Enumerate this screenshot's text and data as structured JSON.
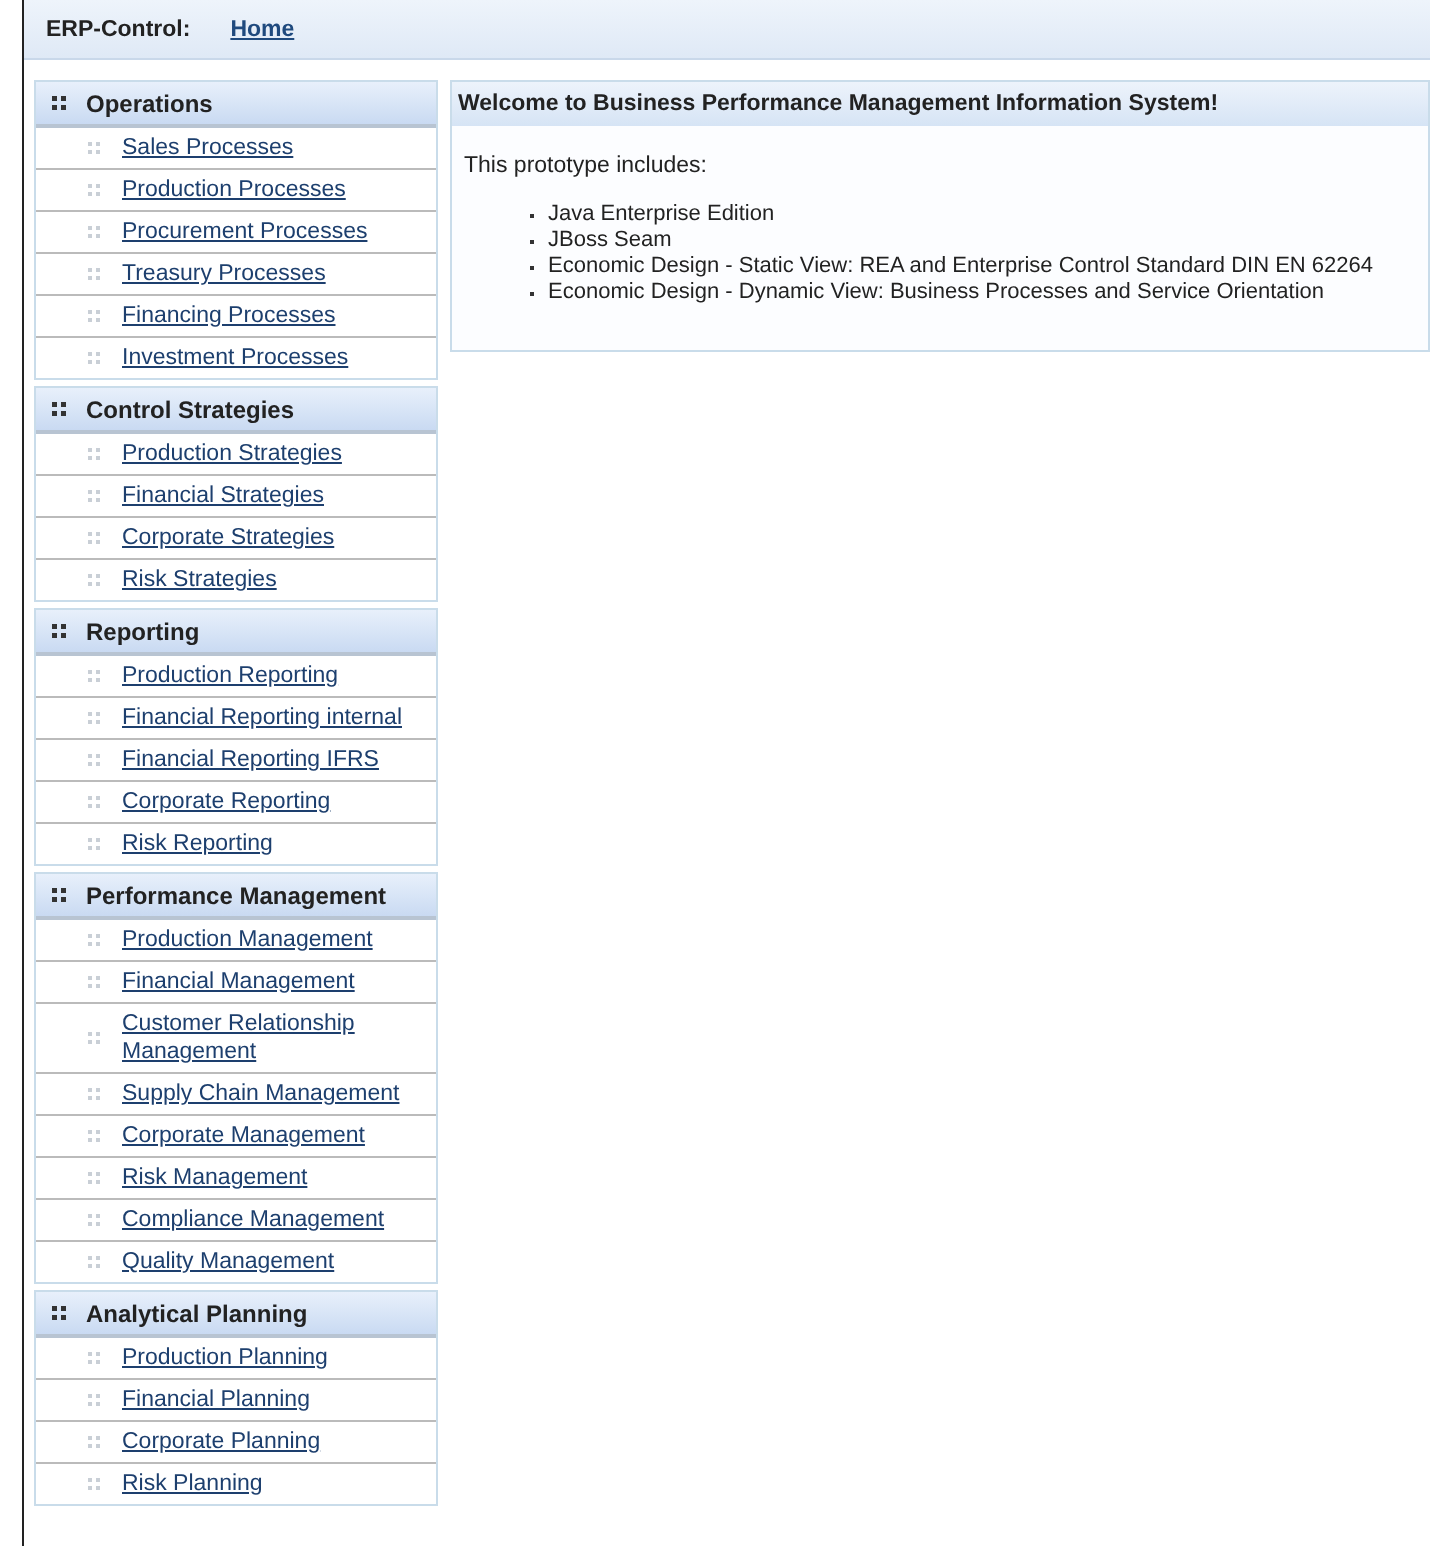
{
  "header": {
    "title": "ERP-Control:",
    "home_link": "Home"
  },
  "sidebar": {
    "sections": [
      {
        "title": "Operations",
        "items": [
          {
            "label": "Sales Processes"
          },
          {
            "label": "Production Processes"
          },
          {
            "label": "Procurement Processes"
          },
          {
            "label": "Treasury Processes"
          },
          {
            "label": "Financing Processes"
          },
          {
            "label": "Investment Processes"
          }
        ]
      },
      {
        "title": "Control Strategies",
        "items": [
          {
            "label": "Production Strategies"
          },
          {
            "label": "Financial Strategies"
          },
          {
            "label": "Corporate Strategies"
          },
          {
            "label": "Risk Strategies"
          }
        ]
      },
      {
        "title": "Reporting",
        "items": [
          {
            "label": "Production Reporting"
          },
          {
            "label": "Financial Reporting internal"
          },
          {
            "label": "Financial Reporting IFRS"
          },
          {
            "label": "Corporate Reporting"
          },
          {
            "label": "Risk Reporting"
          }
        ]
      },
      {
        "title": "Performance Management",
        "items": [
          {
            "label": "Production Management"
          },
          {
            "label": "Financial Management"
          },
          {
            "label": "Customer Relationship Management"
          },
          {
            "label": "Supply Chain Management"
          },
          {
            "label": "Corporate Management"
          },
          {
            "label": "Risk Management"
          },
          {
            "label": "Compliance Management"
          },
          {
            "label": "Quality Management"
          }
        ]
      },
      {
        "title": "Analytical Planning",
        "items": [
          {
            "label": "Production Planning"
          },
          {
            "label": "Financial Planning"
          },
          {
            "label": "Corporate Planning"
          },
          {
            "label": "Risk Planning"
          }
        ]
      }
    ]
  },
  "panel": {
    "title": "Welcome to Business Performance Management Information System!",
    "intro": "This prototype includes:",
    "bullets": [
      "Java Enterprise Edition",
      "JBoss Seam",
      "Economic Design - Static View: REA and Enterprise Control Standard DIN EN 62264",
      "Economic Design - Dynamic View: Business Processes and Service Orientation"
    ]
  }
}
